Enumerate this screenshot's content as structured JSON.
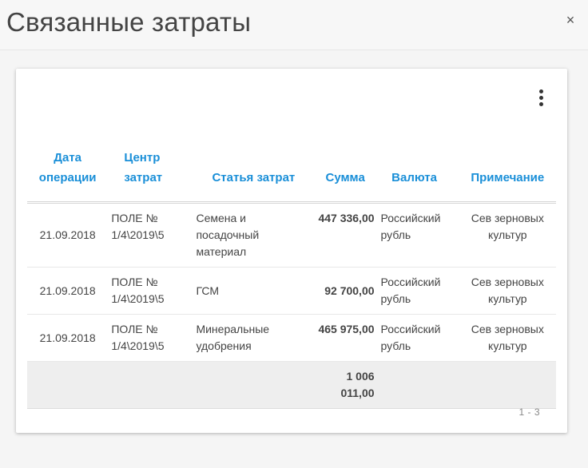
{
  "dialog": {
    "title": "Связанные затраты",
    "close_label": "×"
  },
  "table": {
    "columns": [
      "Дата операции",
      "Центр затрат",
      "Статья затрат",
      "Сумма",
      "Валюта",
      "Примечание"
    ],
    "rows": [
      [
        "21.09.2018",
        "ПОЛЕ № 1/4\\2019\\5",
        "Семена и посадочный материал",
        "447 336,00",
        "Российский рубль",
        "Сев зерновых культур"
      ],
      [
        "21.09.2018",
        "ПОЛЕ № 1/4\\2019\\5",
        "ГСМ",
        "92 700,00",
        "Российский рубль",
        "Сев зерновых культур"
      ],
      [
        "21.09.2018",
        "ПОЛЕ № 1/4\\2019\\5",
        "Минеральные удобрения",
        "465 975,00",
        "Российский рубль",
        "Сев зерновых культур"
      ]
    ],
    "total": "1 006 011,00"
  },
  "pager": {
    "range": "1 - 3"
  },
  "icons": {
    "close": "close-icon",
    "more": "more-vertical-icon"
  },
  "colors": {
    "header_accent": "#1a8fd8"
  }
}
